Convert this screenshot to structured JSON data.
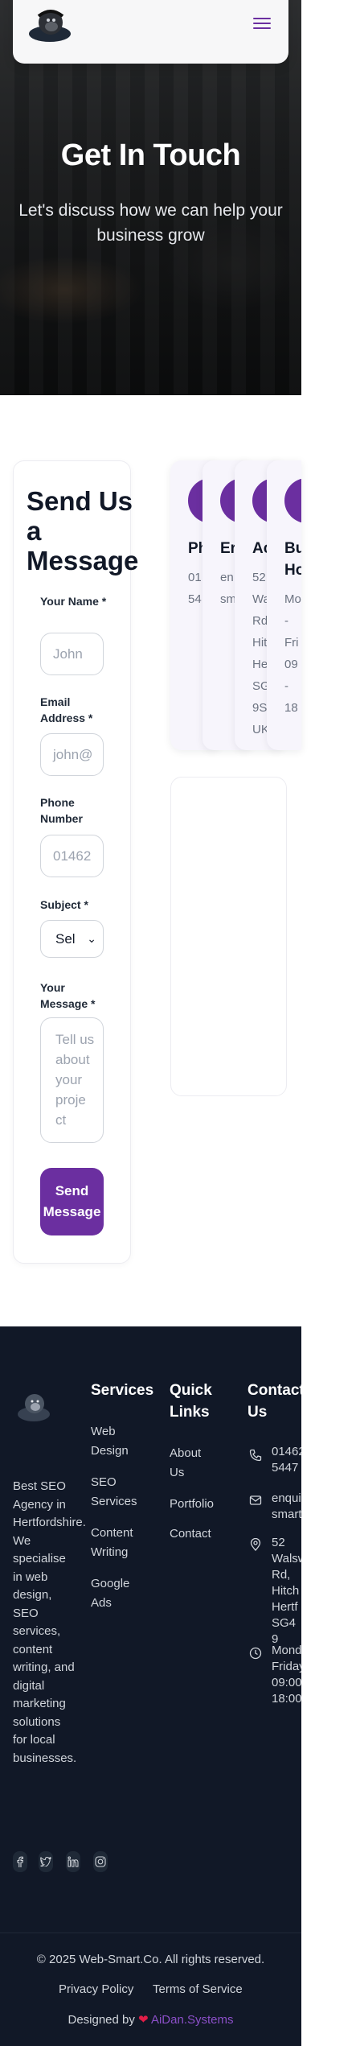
{
  "hero": {
    "title": "Get In Touch",
    "subtitle": "Let's discuss how we can help your business grow"
  },
  "form": {
    "title": "Send Us a Message",
    "name_label": "Your Name *",
    "name_placeholder": "John",
    "email_label": "Email Address *",
    "email_placeholder": "john@",
    "phone_label": "Phone Number",
    "phone_placeholder": "01462",
    "subject_label": "Subject *",
    "subject_value": "Sel",
    "message_label": "Your Message *",
    "message_placeholder": "Tell us about your proje ct",
    "submit_label": "Send Message"
  },
  "contact_cards": [
    {
      "title": "Ph",
      "lines": [
        "01",
        "54"
      ]
    },
    {
      "title": "Er",
      "lines": [
        "en",
        "sm"
      ]
    },
    {
      "title": "Ac",
      "lines": [
        "52",
        "Wa",
        "Rd",
        "Hit",
        "He",
        "SG",
        "9S",
        "UK"
      ]
    },
    {
      "title": "Bu Ho",
      "lines": [
        "Mo",
        "-",
        "Fri",
        "09",
        "-",
        "18"
      ]
    }
  ],
  "footer": {
    "description": "Best SEO Agency in Hertfordshire. We specialise in web design, SEO services, content writing, and digital marketing solutions for local businesses.",
    "services_heading": "Services",
    "services": [
      "Web Design",
      "SEO Services",
      "Content Writing",
      "Google Ads"
    ],
    "quick_links_heading": "Quick Links",
    "quick_links": [
      "About Us",
      "Portfolio",
      "Contact"
    ],
    "contact_heading": "Contact Us",
    "contact": {
      "phone": "01462 5447",
      "email": "enqui smart",
      "address": "52 Walsw Rd, Hitch Hertf SG4 9",
      "hours": "Mond Friday 09:00 18:00"
    },
    "copyright": "© 2025 Web-Smart.Co. All rights reserved.",
    "privacy": "Privacy Policy",
    "terms": "Terms of Service",
    "designed_by": "Designed by",
    "designer": "AiDan.Systems"
  },
  "colors": {
    "accent": "#6b2fa0",
    "footer_bg": "#111827",
    "heart": "#e11d48"
  },
  "icons": [
    "menu-icon",
    "phone-icon",
    "mail-icon",
    "map-pin-icon",
    "clock-icon",
    "facebook-icon",
    "twitter-icon",
    "linkedin-icon",
    "instagram-icon",
    "heart-icon"
  ]
}
